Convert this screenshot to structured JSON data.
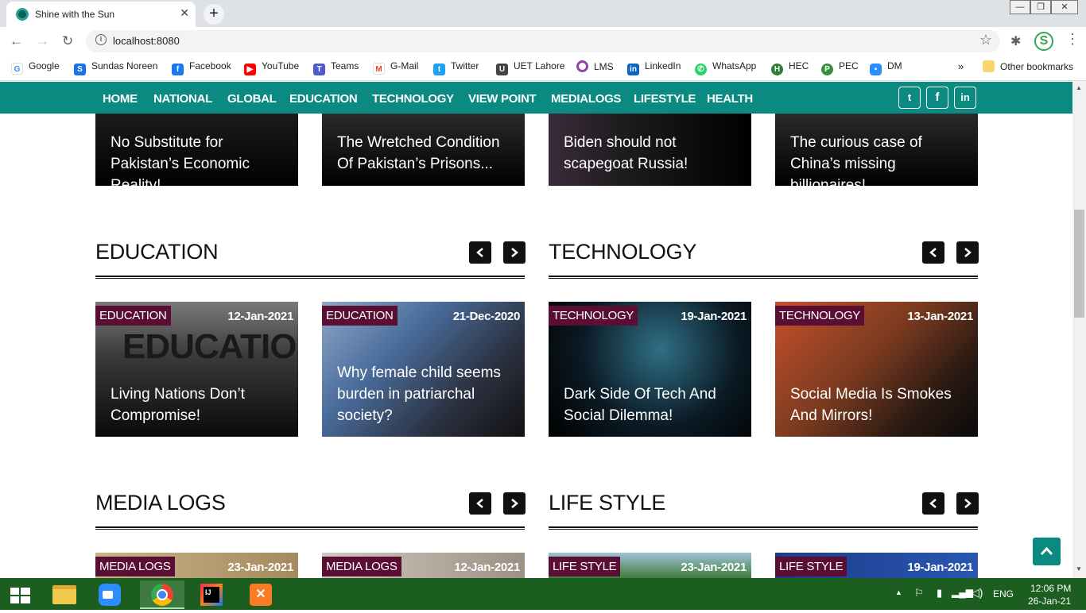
{
  "browser": {
    "tab_title": "Shine with the Sun",
    "url": "localhost:8080",
    "profile_initial": "S",
    "bookmarks": [
      {
        "label": "Google",
        "icon": "google-icon"
      },
      {
        "label": "Sundas Noreen",
        "icon": "s-icon"
      },
      {
        "label": "Facebook",
        "icon": "facebook-icon"
      },
      {
        "label": "YouTube",
        "icon": "youtube-icon"
      },
      {
        "label": "Teams",
        "icon": "teams-icon"
      },
      {
        "label": "G-Mail",
        "icon": "gmail-icon"
      },
      {
        "label": "Twitter",
        "icon": "twitter-icon"
      },
      {
        "label": "UET Lahore",
        "icon": "uet-icon"
      },
      {
        "label": "LMS",
        "icon": "lms-icon"
      },
      {
        "label": "LinkedIn",
        "icon": "linkedin-icon"
      },
      {
        "label": "WhatsApp",
        "icon": "whatsapp-icon"
      },
      {
        "label": "HEC",
        "icon": "hec-icon"
      },
      {
        "label": "PEC",
        "icon": "pec-icon"
      },
      {
        "label": "DM",
        "icon": "zoom-icon"
      }
    ],
    "overflow": "»",
    "other_bookmarks": "Other bookmarks"
  },
  "site": {
    "nav": [
      "HOME",
      "NATIONAL",
      "GLOBAL",
      "EDUCATION",
      "TECHNOLOGY",
      "VIEW POINT",
      "MEDIALOGS",
      "LIFESTYLE",
      "HEALTH"
    ],
    "social": [
      "twitter-icon",
      "facebook-icon",
      "linkedin-icon"
    ],
    "top_cards": [
      {
        "title": "No Substitute for Pakistan’s Economic Reality!"
      },
      {
        "title": "The Wretched Condition Of Pakistan’s Prisons..."
      },
      {
        "title": "Biden should not scapegoat Russia!"
      },
      {
        "title": "The curious case of China’s missing billionaires!"
      }
    ],
    "sections": [
      {
        "title": "EDUCATION",
        "cards": [
          {
            "badge": "EDUCATION",
            "date": "12-Jan-2021",
            "title": "Living Nations Don’t Compromise!",
            "image_text": "EDUCATION"
          },
          {
            "badge": "EDUCATION",
            "date": "21-Dec-2020",
            "title": "Why female child seems burden in patriarchal society?"
          }
        ]
      },
      {
        "title": "TECHNOLOGY",
        "cards": [
          {
            "badge": "TECHNOLOGY",
            "date": "19-Jan-2021",
            "title": "Dark Side Of Tech And Social Dilemma!"
          },
          {
            "badge": "TECHNOLOGY",
            "date": "13-Jan-2021",
            "title": "Social Media Is Smokes And Mirrors!"
          }
        ]
      },
      {
        "title": "MEDIA LOGS",
        "cards": [
          {
            "badge": "MEDIA LOGS",
            "date": "23-Jan-2021"
          },
          {
            "badge": "MEDIA LOGS",
            "date": "12-Jan-2021"
          }
        ]
      },
      {
        "title": "LIFE STYLE",
        "cards": [
          {
            "badge": "LIFE STYLE",
            "date": "23-Jan-2021"
          },
          {
            "badge": "LIFE STYLE",
            "date": "19-Jan-2021"
          }
        ]
      }
    ]
  },
  "taskbar": {
    "lang": "ENG",
    "time": "12:06 PM",
    "date": "26-Jan-21"
  },
  "colors": {
    "nav_bg": "#0a8a80",
    "badge_bg": "#5a0e33",
    "taskbar_bg": "#1b5e20"
  }
}
